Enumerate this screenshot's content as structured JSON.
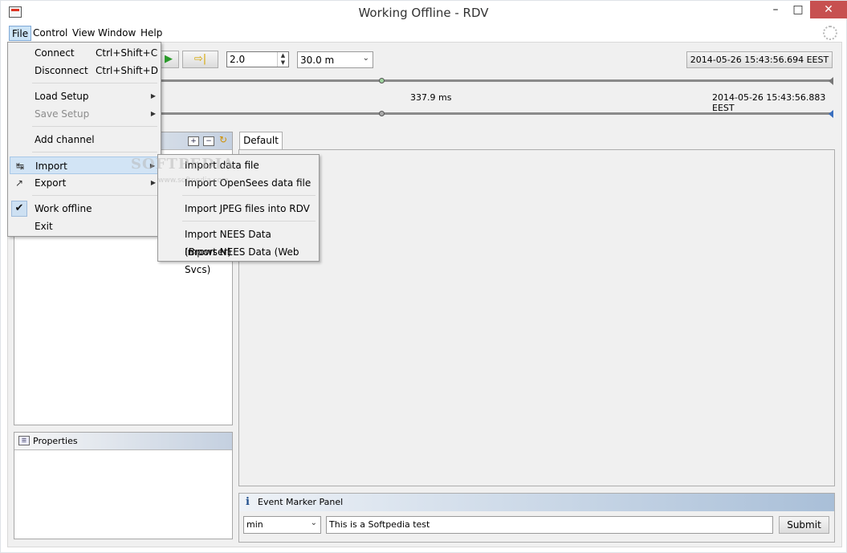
{
  "window": {
    "title": "Working Offline - RDV"
  },
  "titlebar": {
    "min_glyph": "–",
    "max_glyph": "□",
    "close_glyph": "✕"
  },
  "menubar": {
    "items": [
      {
        "label": "File"
      },
      {
        "label": "Control"
      },
      {
        "label": "View"
      },
      {
        "label": "Window"
      },
      {
        "label": "Help"
      }
    ]
  },
  "toolbar": {
    "forward_glyph": "⇨|",
    "play_glyph": "▶",
    "rate_value": "2.0",
    "time_scale": "30.0 m",
    "timestamp": "2014-05-26 15:43:56.694 EEST"
  },
  "timeline": {
    "duration": "337.9 ms",
    "end_time": "2014-05-26 15:43:56.883 EEST"
  },
  "panels": {
    "properties_title": "Properties",
    "tab_default": "Default",
    "event_marker_title": "Event Marker Panel",
    "event_type_value": "min",
    "event_text_value": "This is a Softpedia test",
    "submit_label": "Submit"
  },
  "file_menu": {
    "connect": {
      "label": "Connect",
      "shortcut": "Ctrl+Shift+C"
    },
    "disconnect": {
      "label": "Disconnect",
      "shortcut": "Ctrl+Shift+D"
    },
    "load_setup": "Load Setup",
    "save_setup": "Save Setup",
    "add_channel": "Add channel",
    "import": "Import",
    "export": "Export",
    "work_offline": "Work offline",
    "exit": "Exit"
  },
  "import_submenu": {
    "items": [
      "Import data file",
      "Import OpenSees data file",
      "Import JPEG files into RDV",
      "Import NEES Data (Browser)",
      "Import NEES Data (Web Svcs)"
    ]
  },
  "watermark": {
    "text": "SOFTPEDIA",
    "url": "www.softpedia.com"
  },
  "colors": {
    "close_button": "#c75050",
    "menu_highlight": "#d2e4f5",
    "header_gradient_end": "#a9bfd8"
  }
}
